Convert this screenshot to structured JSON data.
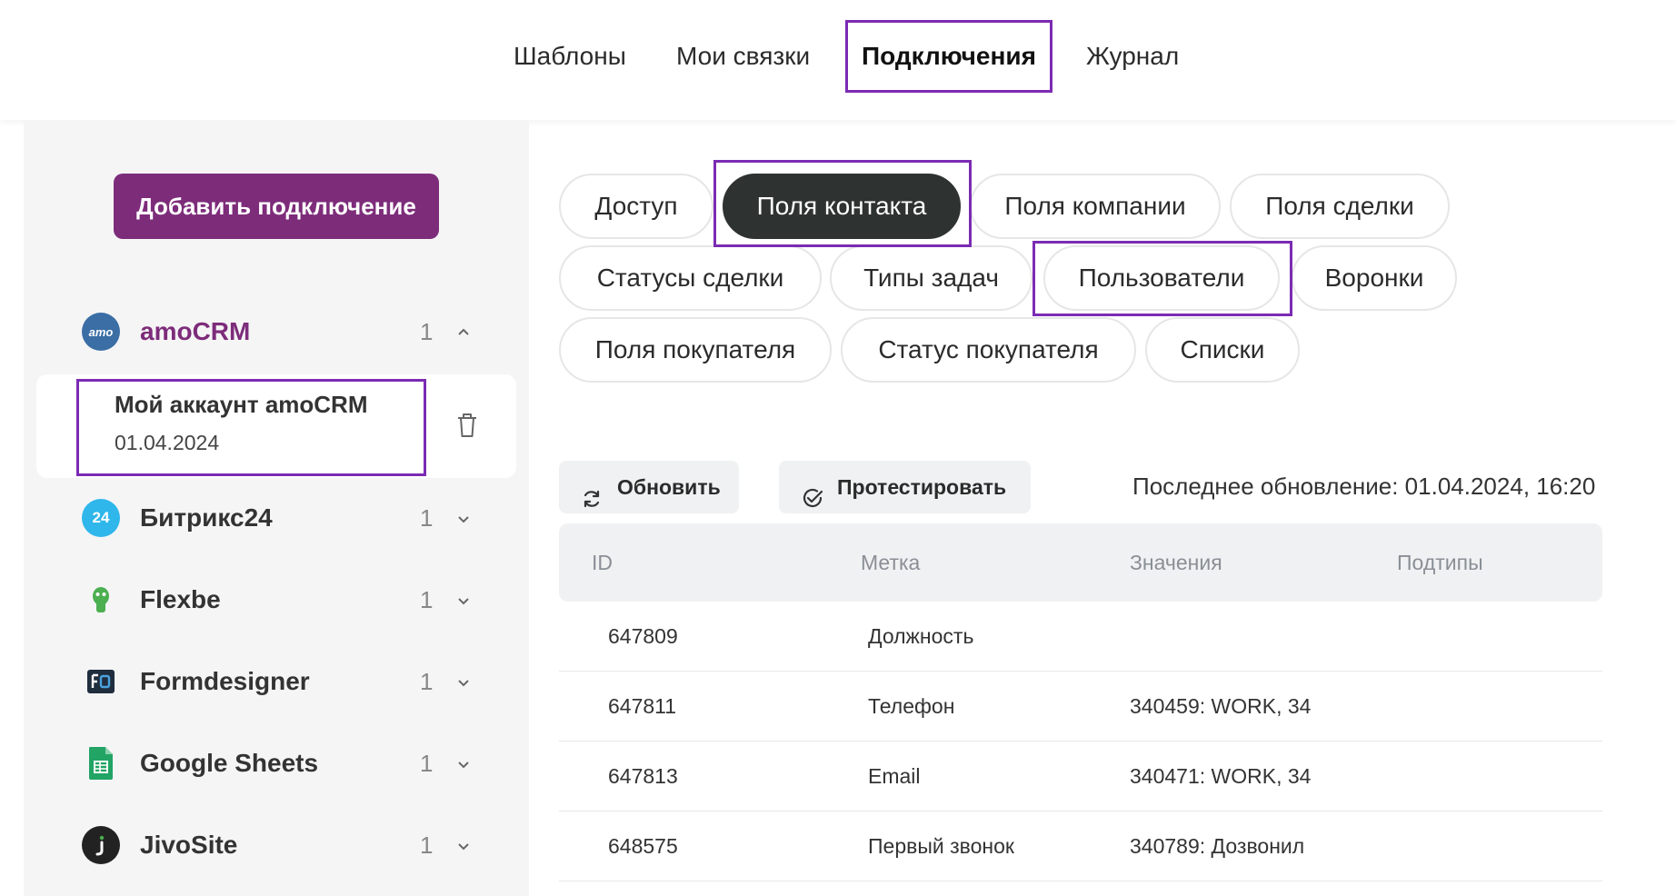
{
  "topnav": {
    "tabs": [
      "Шаблоны",
      "Мои связки",
      "Подключения",
      "Журнал"
    ],
    "active": "Подключения"
  },
  "sidebar": {
    "add_button": "Добавить подключение",
    "services": [
      {
        "name": "amoCRM",
        "count": "1",
        "expanded": true,
        "icon": "amocrm-logo-icon",
        "color": "#3a6ea5",
        "name_color": "#7d2c7a"
      },
      {
        "name": "Битрикс24",
        "count": "1",
        "expanded": false,
        "icon": "bitrix24-logo-icon",
        "color": "#2fb6ea",
        "name_color": "#333333"
      },
      {
        "name": "Flexbe",
        "count": "1",
        "expanded": false,
        "icon": "flexbe-logo-icon",
        "color": "#4caf50",
        "name_color": "#333333"
      },
      {
        "name": "Formdesigner",
        "count": "1",
        "expanded": false,
        "icon": "formdesigner-logo-icon",
        "color": "#1f2d3d",
        "name_color": "#333333"
      },
      {
        "name": "Google Sheets",
        "count": "1",
        "expanded": false,
        "icon": "google-sheets-logo-icon",
        "color": "#21a464",
        "name_color": "#333333"
      },
      {
        "name": "JivoSite",
        "count": "1",
        "expanded": false,
        "icon": "jivosite-logo-icon",
        "color": "#222222",
        "name_color": "#333333"
      }
    ],
    "account": {
      "name": "Мой аккаунт amoCRM",
      "date": "01.04.2024"
    },
    "amo_badge": "amo",
    "bitrix_badge": "24"
  },
  "pills": [
    "Доступ",
    "Поля контакта",
    "Поля компании",
    "Поля сделки",
    "Статусы сделки",
    "Типы задач",
    "Пользователи",
    "Воронки",
    "Поля покупателя",
    "Статус покупателя",
    "Списки"
  ],
  "active_pill": "Поля контакта",
  "actions": {
    "refresh": "Обновить",
    "test": "Протестировать",
    "last_update": "Последнее обновление: 01.04.2024, 16:20"
  },
  "table": {
    "columns": [
      "ID",
      "Метка",
      "Значения",
      "Подтипы"
    ],
    "rows": [
      [
        "647809",
        "Должность",
        "",
        ""
      ],
      [
        "647811",
        "Телефон",
        "340459: WORK, 34",
        ""
      ],
      [
        "647813",
        "Email",
        "340471: WORK, 34",
        ""
      ],
      [
        "648575",
        "Первый звонок",
        "340789: Дозвонил",
        ""
      ]
    ]
  },
  "colors": {
    "accent": "#7d2c7a",
    "highlight": "#7b2bb3",
    "active_pill": "#2e3332"
  }
}
